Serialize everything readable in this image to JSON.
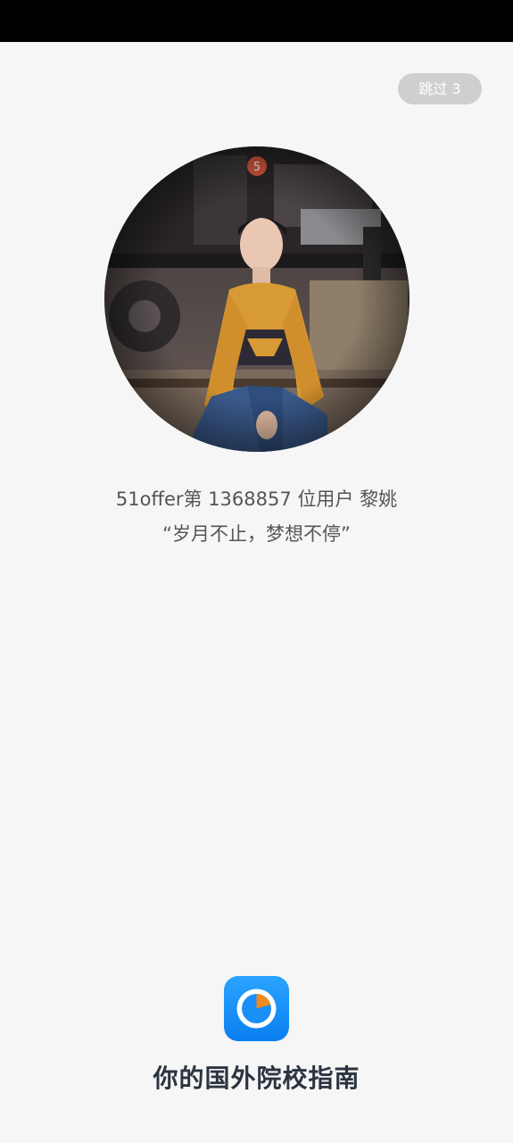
{
  "skip": {
    "label": "跳过 3"
  },
  "avatar": {
    "badge": "5"
  },
  "user": {
    "line": "51offer第 1368857 位用户 黎姚",
    "quote": "“岁月不止，梦想不停”"
  },
  "app": {
    "icon": "51offer-app-icon",
    "slogan": "你的国外院校指南"
  },
  "colors": {
    "background": "#f6f6f7",
    "status_bar": "#000000",
    "skip_bg": "#cfcfcf",
    "accent_blue": "#1a8ff7",
    "accent_orange": "#f28a1e",
    "text": "#555555",
    "slogan": "#2c3440"
  }
}
